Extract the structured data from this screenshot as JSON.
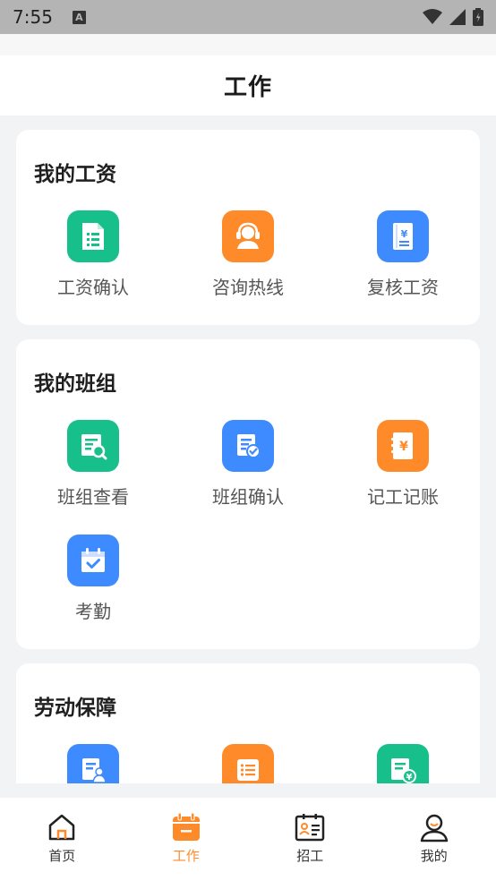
{
  "status_bar": {
    "time": "7:55",
    "notification_letter": "A"
  },
  "header": {
    "title": "工作"
  },
  "sections": [
    {
      "title": "我的工资",
      "items": [
        {
          "label": "工资确认",
          "icon": "spreadsheet-icon",
          "color": "#17c08a"
        },
        {
          "label": "咨询热线",
          "icon": "headset-icon",
          "color": "#ff8a2a"
        },
        {
          "label": "复核工资",
          "icon": "payroll-book-icon",
          "color": "#3d8bff"
        }
      ]
    },
    {
      "title": "我的班组",
      "items": [
        {
          "label": "班组查看",
          "icon": "doc-search-icon",
          "color": "#17c08a"
        },
        {
          "label": "班组确认",
          "icon": "doc-check-icon",
          "color": "#3d8bff"
        },
        {
          "label": "记工记账",
          "icon": "ledger-icon",
          "color": "#ff8a2a"
        },
        {
          "label": "考勤",
          "icon": "calendar-check-icon",
          "color": "#3d8bff"
        }
      ]
    },
    {
      "title": "劳动保障",
      "items": [
        {
          "label": "",
          "icon": "doc-person-icon",
          "color": "#3d8bff"
        },
        {
          "label": "",
          "icon": "list-icon",
          "color": "#ff8a2a"
        },
        {
          "label": "",
          "icon": "doc-yuan-icon",
          "color": "#17c08a"
        }
      ]
    }
  ],
  "tabbar": {
    "items": [
      {
        "label": "首页",
        "icon": "home-icon",
        "active": false
      },
      {
        "label": "工作",
        "icon": "work-calendar-icon",
        "active": true
      },
      {
        "label": "招工",
        "icon": "recruit-board-icon",
        "active": false
      },
      {
        "label": "我的",
        "icon": "user-icon",
        "active": false
      }
    ],
    "active_color": "#ff8a2a"
  }
}
